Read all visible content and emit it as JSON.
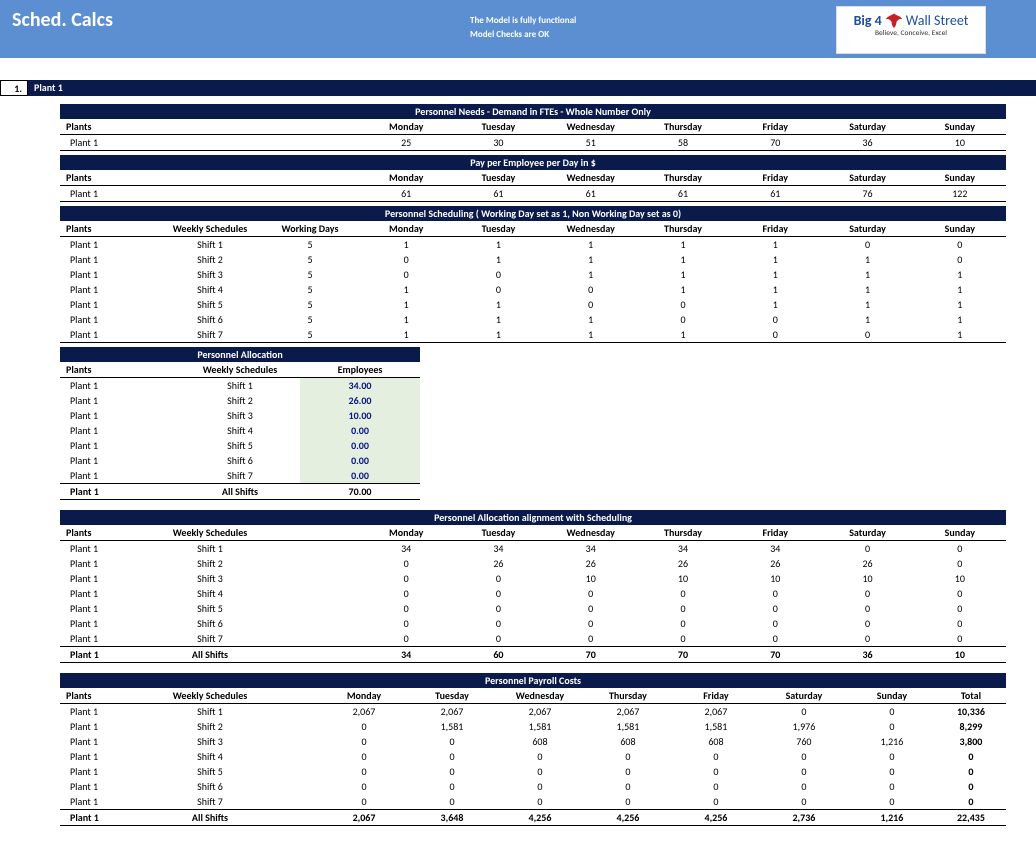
{
  "header": {
    "title": "Sched. Calcs",
    "msg1": "The Model is fully functional",
    "msg2": "Model Checks are OK",
    "logo_big4": "Big 4",
    "logo_ws": "Wall Street",
    "logo_tag": "Believe, Conceive, Excel"
  },
  "section": {
    "num": "1.",
    "name": "Plant 1"
  },
  "days": [
    "Monday",
    "Tuesday",
    "Wednesday",
    "Thursday",
    "Friday",
    "Saturday",
    "Sunday"
  ],
  "labels": {
    "plants": "Plants",
    "plant1": "Plant 1",
    "weekly_schedules": "Weekly Schedules",
    "working_days": "Working Days",
    "employees": "Employees",
    "all_shifts": "All Shifts",
    "total": "Total"
  },
  "bands": {
    "needs": "Personnel Needs - Demand in FTEs - Whole Number Only",
    "pay": "Pay per Employee per Day in $",
    "sched": "Personnel Scheduling ( Working Day set as 1, Non Working Day set as 0)",
    "alloc": "Personnel Allocation",
    "align": "Personnel Allocation alignment with Scheduling",
    "payroll": "Personnel Payroll Costs"
  },
  "needs": {
    "row": [
      "",
      "25",
      "30",
      "51",
      "58",
      "70",
      "36",
      "10"
    ]
  },
  "pay": {
    "row": [
      "",
      "61",
      "61",
      "61",
      "61",
      "61",
      "76",
      "122"
    ]
  },
  "shifts": [
    "Shift 1",
    "Shift 2",
    "Shift 3",
    "Shift 4",
    "Shift 5",
    "Shift 6",
    "Shift 7"
  ],
  "sched_rows": [
    {
      "wd": "5",
      "d": [
        "1",
        "1",
        "1",
        "1",
        "1",
        "0",
        "0"
      ]
    },
    {
      "wd": "5",
      "d": [
        "0",
        "1",
        "1",
        "1",
        "1",
        "1",
        "0"
      ]
    },
    {
      "wd": "5",
      "d": [
        "0",
        "0",
        "1",
        "1",
        "1",
        "1",
        "1"
      ]
    },
    {
      "wd": "5",
      "d": [
        "1",
        "0",
        "0",
        "1",
        "1",
        "1",
        "1"
      ]
    },
    {
      "wd": "5",
      "d": [
        "1",
        "1",
        "0",
        "0",
        "1",
        "1",
        "1"
      ]
    },
    {
      "wd": "5",
      "d": [
        "1",
        "1",
        "1",
        "0",
        "0",
        "1",
        "1"
      ]
    },
    {
      "wd": "5",
      "d": [
        "1",
        "1",
        "1",
        "1",
        "0",
        "0",
        "1"
      ]
    }
  ],
  "alloc_rows": [
    "34.00",
    "26.00",
    "10.00",
    "0.00",
    "0.00",
    "0.00",
    "0.00"
  ],
  "alloc_total": "70.00",
  "align_rows": [
    [
      "34",
      "34",
      "34",
      "34",
      "34",
      "0",
      "0"
    ],
    [
      "0",
      "26",
      "26",
      "26",
      "26",
      "26",
      "0"
    ],
    [
      "0",
      "0",
      "10",
      "10",
      "10",
      "10",
      "10"
    ],
    [
      "0",
      "0",
      "0",
      "0",
      "0",
      "0",
      "0"
    ],
    [
      "0",
      "0",
      "0",
      "0",
      "0",
      "0",
      "0"
    ],
    [
      "0",
      "0",
      "0",
      "0",
      "0",
      "0",
      "0"
    ],
    [
      "0",
      "0",
      "0",
      "0",
      "0",
      "0",
      "0"
    ]
  ],
  "align_total": [
    "34",
    "60",
    "70",
    "70",
    "70",
    "36",
    "10"
  ],
  "payroll_rows": [
    {
      "d": [
        "2,067",
        "2,067",
        "2,067",
        "2,067",
        "2,067",
        "0",
        "0"
      ],
      "t": "10,336"
    },
    {
      "d": [
        "0",
        "1,581",
        "1,581",
        "1,581",
        "1,581",
        "1,976",
        "0"
      ],
      "t": "8,299"
    },
    {
      "d": [
        "0",
        "0",
        "608",
        "608",
        "608",
        "760",
        "1,216"
      ],
      "t": "3,800"
    },
    {
      "d": [
        "0",
        "0",
        "0",
        "0",
        "0",
        "0",
        "0"
      ],
      "t": "0"
    },
    {
      "d": [
        "0",
        "0",
        "0",
        "0",
        "0",
        "0",
        "0"
      ],
      "t": "0"
    },
    {
      "d": [
        "0",
        "0",
        "0",
        "0",
        "0",
        "0",
        "0"
      ],
      "t": "0"
    },
    {
      "d": [
        "0",
        "0",
        "0",
        "0",
        "0",
        "0",
        "0"
      ],
      "t": "0"
    }
  ],
  "payroll_total": {
    "d": [
      "2,067",
      "3,648",
      "4,256",
      "4,256",
      "4,256",
      "2,736",
      "1,216"
    ],
    "t": "22,435"
  }
}
